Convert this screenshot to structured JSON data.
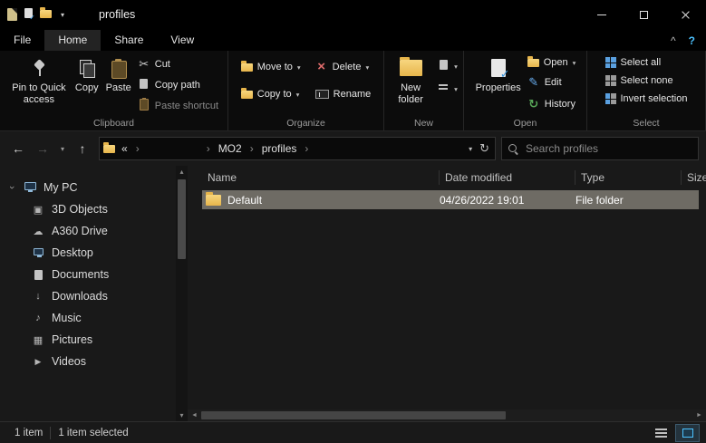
{
  "titlebar": {
    "title": "profiles"
  },
  "icons": {
    "back": "←",
    "forward": "→",
    "up": "↑",
    "dropdown": "▾",
    "refresh": "↻",
    "overflow": "«",
    "separator": "›",
    "cut": "✂",
    "delete": "×",
    "edit": "✎",
    "history": "↻",
    "expander": "›",
    "collapse_ribbon": "^",
    "help": "?",
    "music": "♪",
    "cloud": "☁",
    "download": "↓",
    "video": "▶",
    "pictures": "▦",
    "objects_3d": "▣",
    "scroll_up": "▴",
    "scroll_down": "▾",
    "scroll_left": "◄",
    "scroll_right": "►"
  },
  "ribbon": {
    "tabs": [
      "File",
      "Home",
      "Share",
      "View"
    ],
    "clipboard": {
      "label": "Clipboard",
      "pin": "Pin to Quick access",
      "copy": "Copy",
      "paste": "Paste",
      "cut": "Cut",
      "copy_path": "Copy path",
      "paste_shortcut": "Paste shortcut"
    },
    "organize": {
      "label": "Organize",
      "move_to": "Move to",
      "delete": "Delete",
      "copy_to": "Copy to",
      "rename": "Rename"
    },
    "new_group": {
      "label": "New",
      "new_folder": "New folder"
    },
    "open_group": {
      "label": "Open",
      "properties": "Properties",
      "open": "Open",
      "edit": "Edit",
      "history": "History"
    },
    "select_group": {
      "label": "Select",
      "select_all": "Select all",
      "select_none": "Select none",
      "invert": "Invert selection"
    }
  },
  "addressbar": {
    "breadcrumb": [
      "MO2",
      "profiles"
    ],
    "search_placeholder": "Search profiles"
  },
  "sidebar": {
    "items": [
      "My PC",
      "3D Objects",
      "A360 Drive",
      "Desktop",
      "Documents",
      "Downloads",
      "Music",
      "Pictures",
      "Videos"
    ]
  },
  "filelist": {
    "columns": [
      "Name",
      "Date modified",
      "Type",
      "Size"
    ],
    "rows": [
      {
        "name": "Default",
        "date_modified": "04/26/2022 19:01",
        "type": "File folder",
        "size": ""
      }
    ]
  },
  "statusbar": {
    "items": "1 item",
    "selected": "1 item selected"
  }
}
